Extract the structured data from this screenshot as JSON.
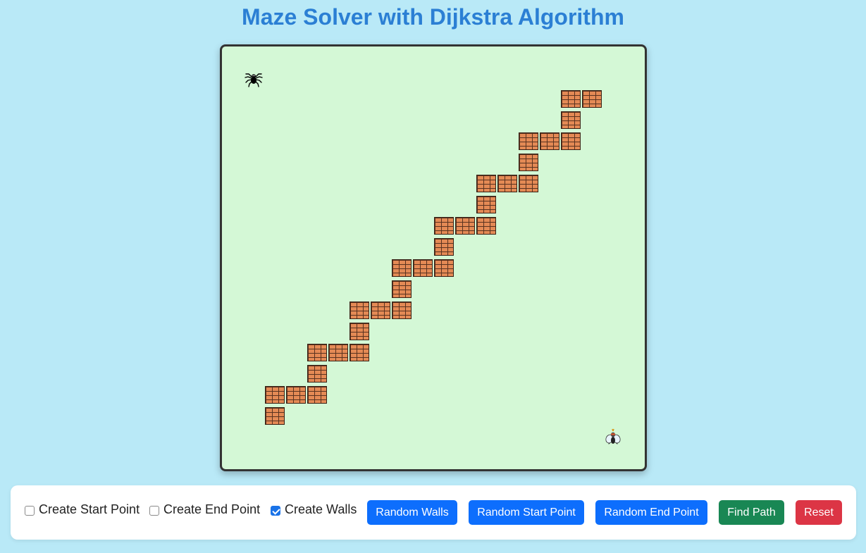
{
  "title": "Maze Solver with Dijkstra Algorithm",
  "grid": {
    "rows": 20,
    "cols": 20,
    "start": {
      "row": 1,
      "col": 1,
      "icon": "spider-icon"
    },
    "end": {
      "row": 18,
      "col": 18,
      "icon": "fly-icon"
    },
    "walls": [
      [
        2,
        16
      ],
      [
        2,
        17
      ],
      [
        3,
        16
      ],
      [
        4,
        14
      ],
      [
        4,
        15
      ],
      [
        4,
        16
      ],
      [
        5,
        14
      ],
      [
        6,
        12
      ],
      [
        6,
        13
      ],
      [
        6,
        14
      ],
      [
        7,
        12
      ],
      [
        8,
        10
      ],
      [
        8,
        11
      ],
      [
        8,
        12
      ],
      [
        9,
        10
      ],
      [
        10,
        8
      ],
      [
        10,
        9
      ],
      [
        10,
        10
      ],
      [
        11,
        8
      ],
      [
        12,
        6
      ],
      [
        12,
        7
      ],
      [
        12,
        8
      ],
      [
        13,
        6
      ],
      [
        14,
        4
      ],
      [
        14,
        5
      ],
      [
        14,
        6
      ],
      [
        15,
        4
      ],
      [
        16,
        2
      ],
      [
        16,
        3
      ],
      [
        16,
        4
      ],
      [
        17,
        2
      ]
    ],
    "colors": {
      "background": "#d4f8d6",
      "brick": "#e48a55",
      "mortar": "#5a3320"
    }
  },
  "controls": {
    "create_start_label": "Create Start Point",
    "create_start_checked": false,
    "create_end_label": "Create End Point",
    "create_end_checked": false,
    "create_walls_label": "Create Walls",
    "create_walls_checked": true,
    "random_walls_label": "Random Walls",
    "random_start_label": "Random Start Point",
    "random_end_label": "Random End Point",
    "find_path_label": "Find Path",
    "reset_label": "Reset"
  },
  "colors": {
    "page_background": "#b9e9f7",
    "title": "#2b7fd4",
    "primary_button": "#0d6efd",
    "success_button": "#198754",
    "danger_button": "#dc3545"
  }
}
